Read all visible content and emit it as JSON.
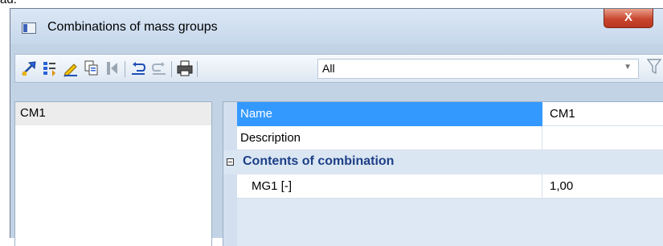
{
  "top_fragment": "ad.",
  "window": {
    "title": "Combinations of mass groups",
    "close_glyph": "X"
  },
  "toolbar": {
    "icons": [
      "new-item-icon",
      "properties-icon",
      "edit-icon",
      "copy-icon",
      "insert-icon",
      "undo-icon",
      "redo-icon",
      "print-icon"
    ],
    "filter_value": "All"
  },
  "list": {
    "items": [
      {
        "label": "CM1"
      }
    ]
  },
  "properties": {
    "name_label": "Name",
    "name_value": "CM1",
    "description_label": "Description",
    "description_value": "",
    "group_toggle": "−",
    "group_title": "Contents of combination",
    "mg_label": "MG1 [-]",
    "mg_value": "1,00"
  },
  "colors": {
    "selection": "#3399ff",
    "group_title": "#1c3f86",
    "close_button": "#c9472f"
  }
}
